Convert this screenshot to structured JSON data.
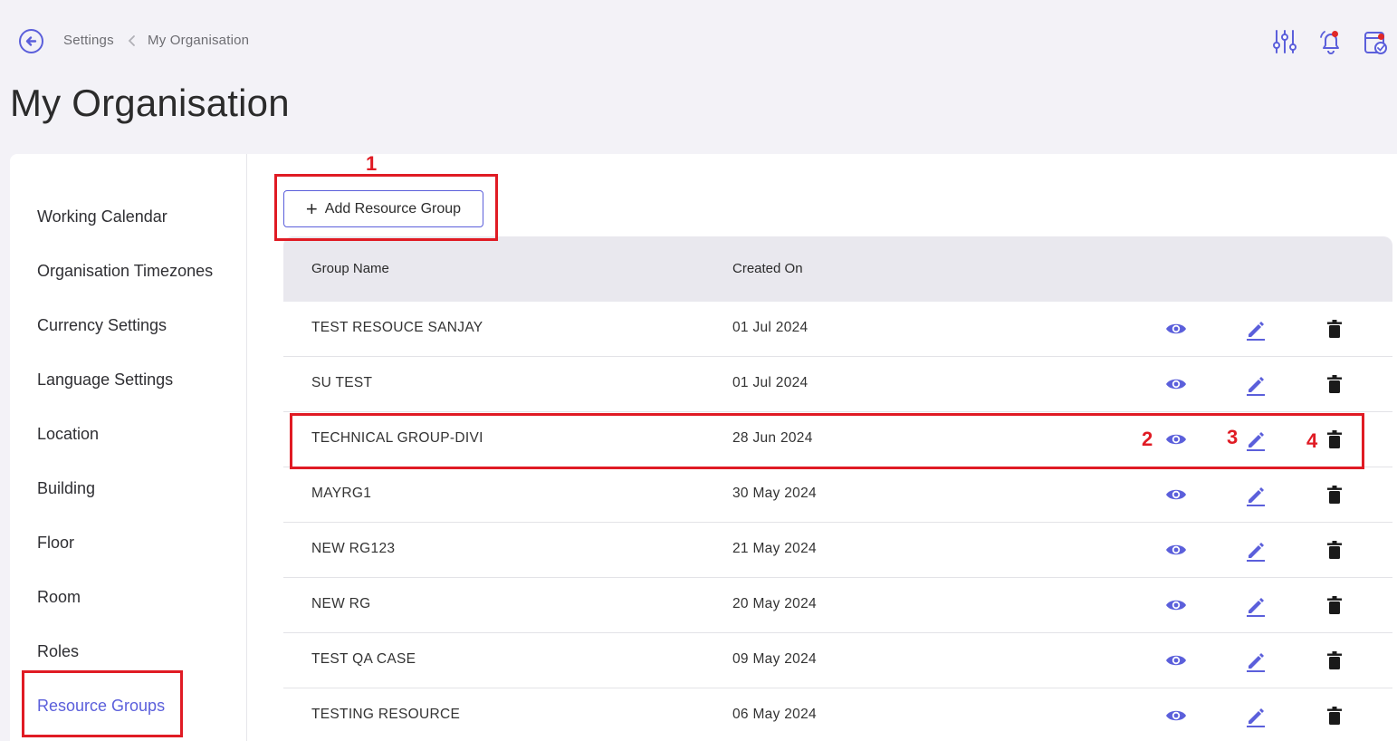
{
  "breadcrumb": {
    "parent": "Settings",
    "current": "My Organisation"
  },
  "page_title": "My Organisation",
  "colors": {
    "accent": "#5b5fdb",
    "highlight": "#e01b24",
    "notification_dot": "#e02828"
  },
  "top_icons": [
    "filter-sliders-icon",
    "notification-bell-icon",
    "calendar-check-icon"
  ],
  "sidebar": {
    "items": [
      {
        "label": "Working Calendar"
      },
      {
        "label": "Organisation Timezones"
      },
      {
        "label": "Currency Settings"
      },
      {
        "label": "Language Settings"
      },
      {
        "label": "Location"
      },
      {
        "label": "Building"
      },
      {
        "label": "Floor"
      },
      {
        "label": "Room"
      },
      {
        "label": "Roles"
      },
      {
        "label": "Resource Groups",
        "active": true
      }
    ]
  },
  "toolbar": {
    "add_label": "Add Resource Group"
  },
  "table": {
    "columns": [
      "Group Name",
      "Created On"
    ],
    "rows": [
      {
        "name": "TEST RESOUCE SANJAY",
        "created": "01 Jul 2024"
      },
      {
        "name": "SU TEST",
        "created": "01 Jul 2024"
      },
      {
        "name": "TECHNICAL GROUP-DIVI",
        "created": "28 Jun 2024"
      },
      {
        "name": "MAYRG1",
        "created": "30 May 2024"
      },
      {
        "name": "NEW RG123",
        "created": "21 May 2024"
      },
      {
        "name": "NEW RG",
        "created": "20 May 2024"
      },
      {
        "name": "TEST QA CASE",
        "created": "09 May 2024"
      },
      {
        "name": "TESTING RESOURCE",
        "created": "06 May 2024"
      }
    ],
    "row_actions": [
      "eye-icon",
      "pencil-icon",
      "trash-icon"
    ]
  },
  "annotations": [
    "1",
    "2",
    "3",
    "4"
  ]
}
